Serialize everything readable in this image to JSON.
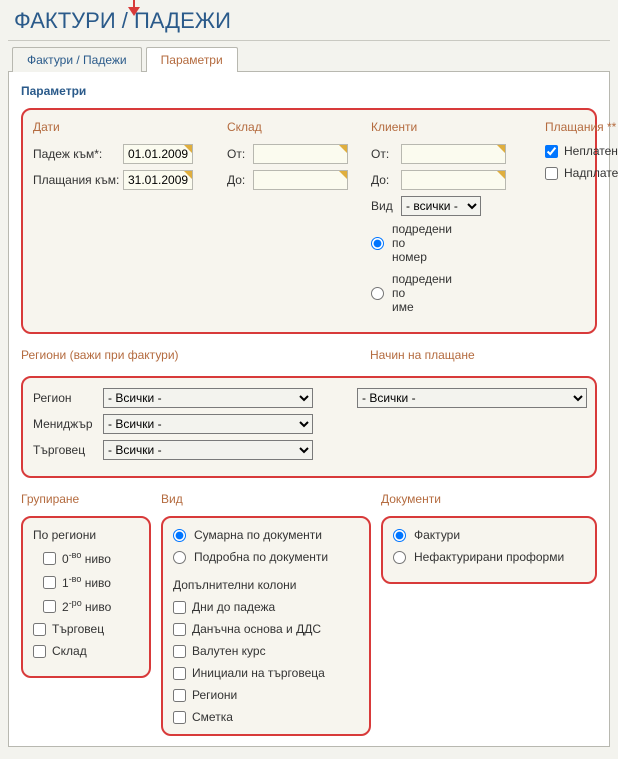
{
  "header": {
    "title": "ФАКТУРИ / ПАДЕЖИ"
  },
  "tabs": {
    "tab1": "Фактури / Падежи",
    "tab2": "Параметри"
  },
  "section_title": "Параметри",
  "panel1": {
    "dates": {
      "header": "Дати",
      "due_label": "Падеж към*:",
      "due_value": "01.01.2009",
      "pay_label": "Плащания към:",
      "pay_value": "31.01.2009"
    },
    "warehouse": {
      "header": "Склад",
      "from_label": "От:",
      "to_label": "До:",
      "from_value": "",
      "to_value": ""
    },
    "clients": {
      "header": "Клиенти",
      "from_label": "От:",
      "to_label": "До:",
      "from_value": "",
      "to_value": "",
      "type_label": "Вид",
      "type_option": "- всички -",
      "sort_number": "подредени по номер",
      "sort_name": "подредени по име"
    },
    "payments": {
      "header": "Плащания **",
      "unpaid": "Неплатени",
      "overpaid": "Надплатени"
    }
  },
  "panel2": {
    "regions_header": "Региони (важи при фактури)",
    "pay_method_header": "Начин на плащане",
    "region_label": "Регион",
    "manager_label": "Мениджър",
    "sales_label": "Търговец",
    "all_option": "- Всички -"
  },
  "grouping": {
    "header": "Групиране",
    "by_regions": "По региони",
    "level0": "0-во ниво",
    "level1": "1-во ниво",
    "level2": "2-ро ниво",
    "sales": "Търговец",
    "warehouse": "Склад"
  },
  "view": {
    "header": "Вид",
    "summary": "Сумарна по документи",
    "detail": "Подробна по документи",
    "extra_cols": "Допълнителни колони",
    "days_due": "Дни до падежа",
    "tax_base": "Данъчна основа и ДДС",
    "fx_rate": "Валутен курс",
    "initials": "Инициали на търговеца",
    "regions": "Региони",
    "account": "Сметка"
  },
  "documents": {
    "header": "Документи",
    "invoices": "Фактури",
    "proforma": "Нефактурирани проформи"
  }
}
